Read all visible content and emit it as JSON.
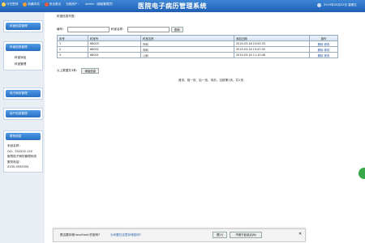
{
  "topbar": {
    "links": [
      "今日签到",
      "收藏本站",
      "安全退出",
      "当前用户：",
      "admin（超级管理员）"
    ],
    "title": "医院电子病历管理系统",
    "date": "2019年03月22日 星期五"
  },
  "sidebar": {
    "panels": [
      {
        "title": "科室信息管理"
      },
      {
        "title": "科室信息管理",
        "items": [
          "科室添加",
          "科室管理"
        ]
      },
      {
        "title": "电子病历管理"
      },
      {
        "title": "用户信息管理"
      },
      {
        "title": "联系信息",
        "lines": [
          "系统名称：",
          "QQ：332222.120",
          "医院电子病历管理系统",
          "服务电话：",
          "0335-5555555"
        ]
      }
    ]
  },
  "main": {
    "breadcrumb": "科室信息列表：",
    "search": {
      "label1": "编号：",
      "label2": "科室名称：",
      "button": "查询"
    },
    "table": {
      "headers": [
        "序号",
        "科室号",
        "科室名称",
        "添加日期",
        "操作"
      ],
      "rows": [
        [
          "1",
          "66003",
          "外科",
          "2019-03-16 15:00:33",
          "删除  修改"
        ],
        [
          "2",
          "66002",
          "内科",
          "2019-03-16 15:47:00",
          "删除  修改"
        ],
        [
          "3",
          "66001",
          "儿科",
          "2019-03-16 11:10:46",
          "删除  修改"
        ]
      ]
    },
    "add_label": "以上数据共3条：",
    "add_button": "添加信息",
    "pager": "首页、前一页、后一页、末页、当前第1页，共1页"
  },
  "notification": {
    "message": "是否要存储 localhost 的密码?",
    "link": "为何要在这里存储密码?",
    "yes_button": "是(Y)",
    "never_button": "不用于此站点(N)",
    "close": "✕"
  },
  "colors": {
    "accent": "#1f5fb3",
    "header_bg": "#cfe0f1",
    "link": "#2a5db0"
  }
}
